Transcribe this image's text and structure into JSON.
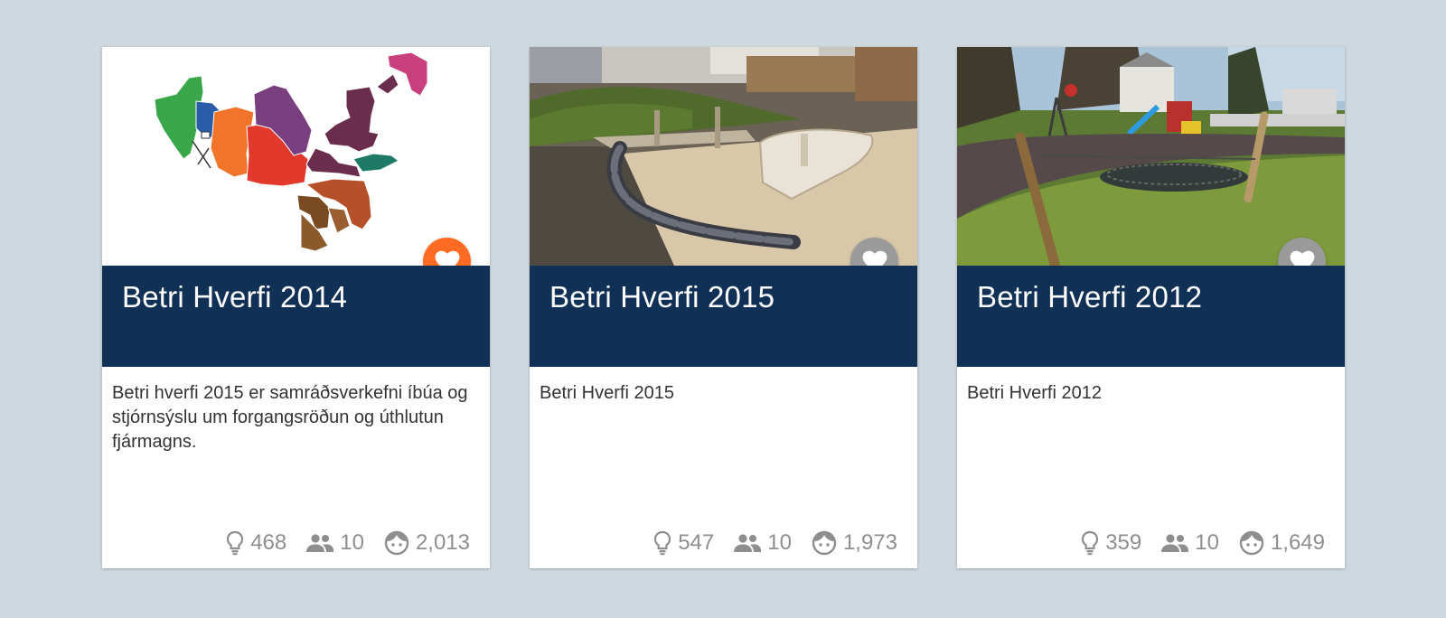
{
  "colors": {
    "background": "#d0d8df",
    "title_band": "#113056",
    "fav_active": "#ff6b22",
    "fav_inactive": "#9a9a9a",
    "stat_text": "#8e8e8e"
  },
  "cards": [
    {
      "title": "Betri Hverfi 2014",
      "description": "Betri hverfi 2015 er samráðsverkefni íbúa og stjórnsýslu um forgangsröðun og úthlutun fjármagns.",
      "image": "district-map",
      "favorite": true,
      "stats": {
        "ideas": "468",
        "groups": "10",
        "users": "2,013"
      }
    },
    {
      "title": "Betri Hverfi 2015",
      "description": "Betri Hverfi 2015",
      "image": "sandbox-playground-photo",
      "favorite": false,
      "stats": {
        "ideas": "547",
        "groups": "10",
        "users": "1,973"
      }
    },
    {
      "title": "Betri Hverfi 2012",
      "description": "Betri Hverfi 2012",
      "image": "swing-playground-photo",
      "favorite": false,
      "stats": {
        "ideas": "359",
        "groups": "10",
        "users": "1,649"
      }
    }
  ],
  "icons": {
    "ideas": "lightbulb-icon",
    "groups": "people-icon",
    "users": "face-icon",
    "favorite": "heart-icon"
  }
}
